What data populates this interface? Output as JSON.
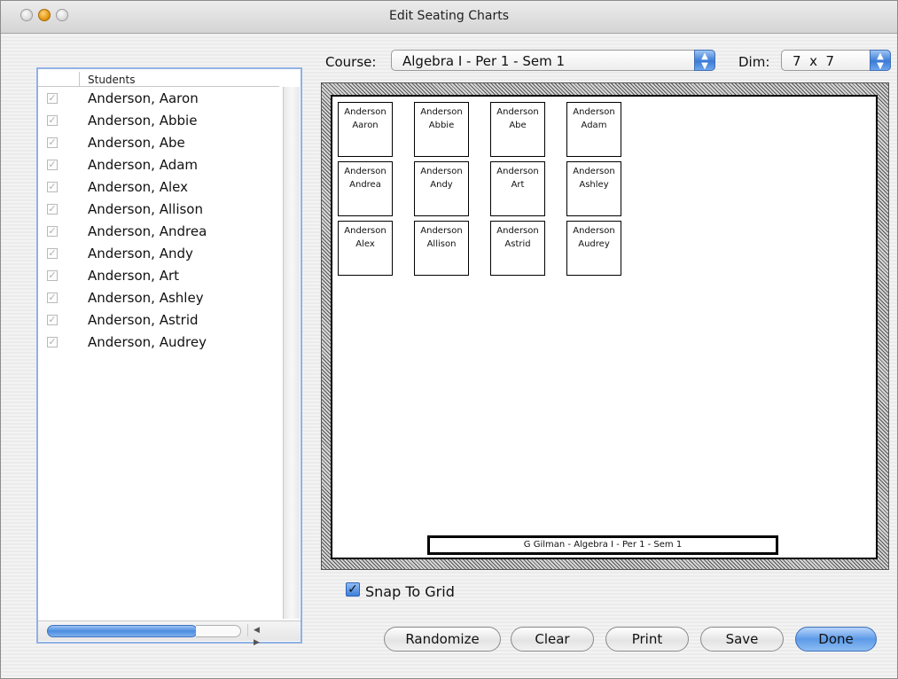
{
  "window": {
    "title": "Edit Seating Charts"
  },
  "students_list": {
    "column_header": "Students",
    "items": [
      {
        "name": "Anderson, Aaron",
        "checked": true
      },
      {
        "name": "Anderson, Abbie",
        "checked": true
      },
      {
        "name": "Anderson, Abe",
        "checked": true
      },
      {
        "name": "Anderson, Adam",
        "checked": true
      },
      {
        "name": "Anderson, Alex",
        "checked": true
      },
      {
        "name": "Anderson, Allison",
        "checked": true
      },
      {
        "name": "Anderson, Andrea",
        "checked": true
      },
      {
        "name": "Anderson, Andy",
        "checked": true
      },
      {
        "name": "Anderson, Art",
        "checked": true
      },
      {
        "name": "Anderson, Ashley",
        "checked": true
      },
      {
        "name": "Anderson, Astrid",
        "checked": true
      },
      {
        "name": "Anderson, Audrey",
        "checked": true
      }
    ]
  },
  "course": {
    "label": "Course:",
    "value": "Algebra I - Per 1 - Sem 1"
  },
  "dim": {
    "label": "Dim:",
    "value": "7  x  7"
  },
  "seating_chart": {
    "seats": [
      [
        "Anderson",
        "Aaron"
      ],
      [
        "Anderson",
        "Abbie"
      ],
      [
        "Anderson",
        "Abe"
      ],
      [
        "Anderson",
        "Adam"
      ],
      [
        "Anderson",
        "Andrea"
      ],
      [
        "Anderson",
        "Andy"
      ],
      [
        "Anderson",
        "Art"
      ],
      [
        "Anderson",
        "Ashley"
      ],
      [
        "Anderson",
        "Alex"
      ],
      [
        "Anderson",
        "Allison"
      ],
      [
        "Anderson",
        "Astrid"
      ],
      [
        "Anderson",
        "Audrey"
      ]
    ],
    "caption": "G Gilman - Algebra I - Per 1 - Sem 1"
  },
  "snap_to_grid": {
    "label": "Snap To Grid",
    "checked": true
  },
  "buttons": {
    "randomize": "Randomize",
    "clear": "Clear",
    "print": "Print",
    "save": "Save",
    "done": "Done"
  },
  "icons": {
    "checkmark": "✓",
    "popup_arrows": "▲▼",
    "scroll_arrows": "◀ ▶"
  },
  "colors": {
    "accent_blue": "#3b7bd7",
    "list_border": "#8fb2e4"
  }
}
